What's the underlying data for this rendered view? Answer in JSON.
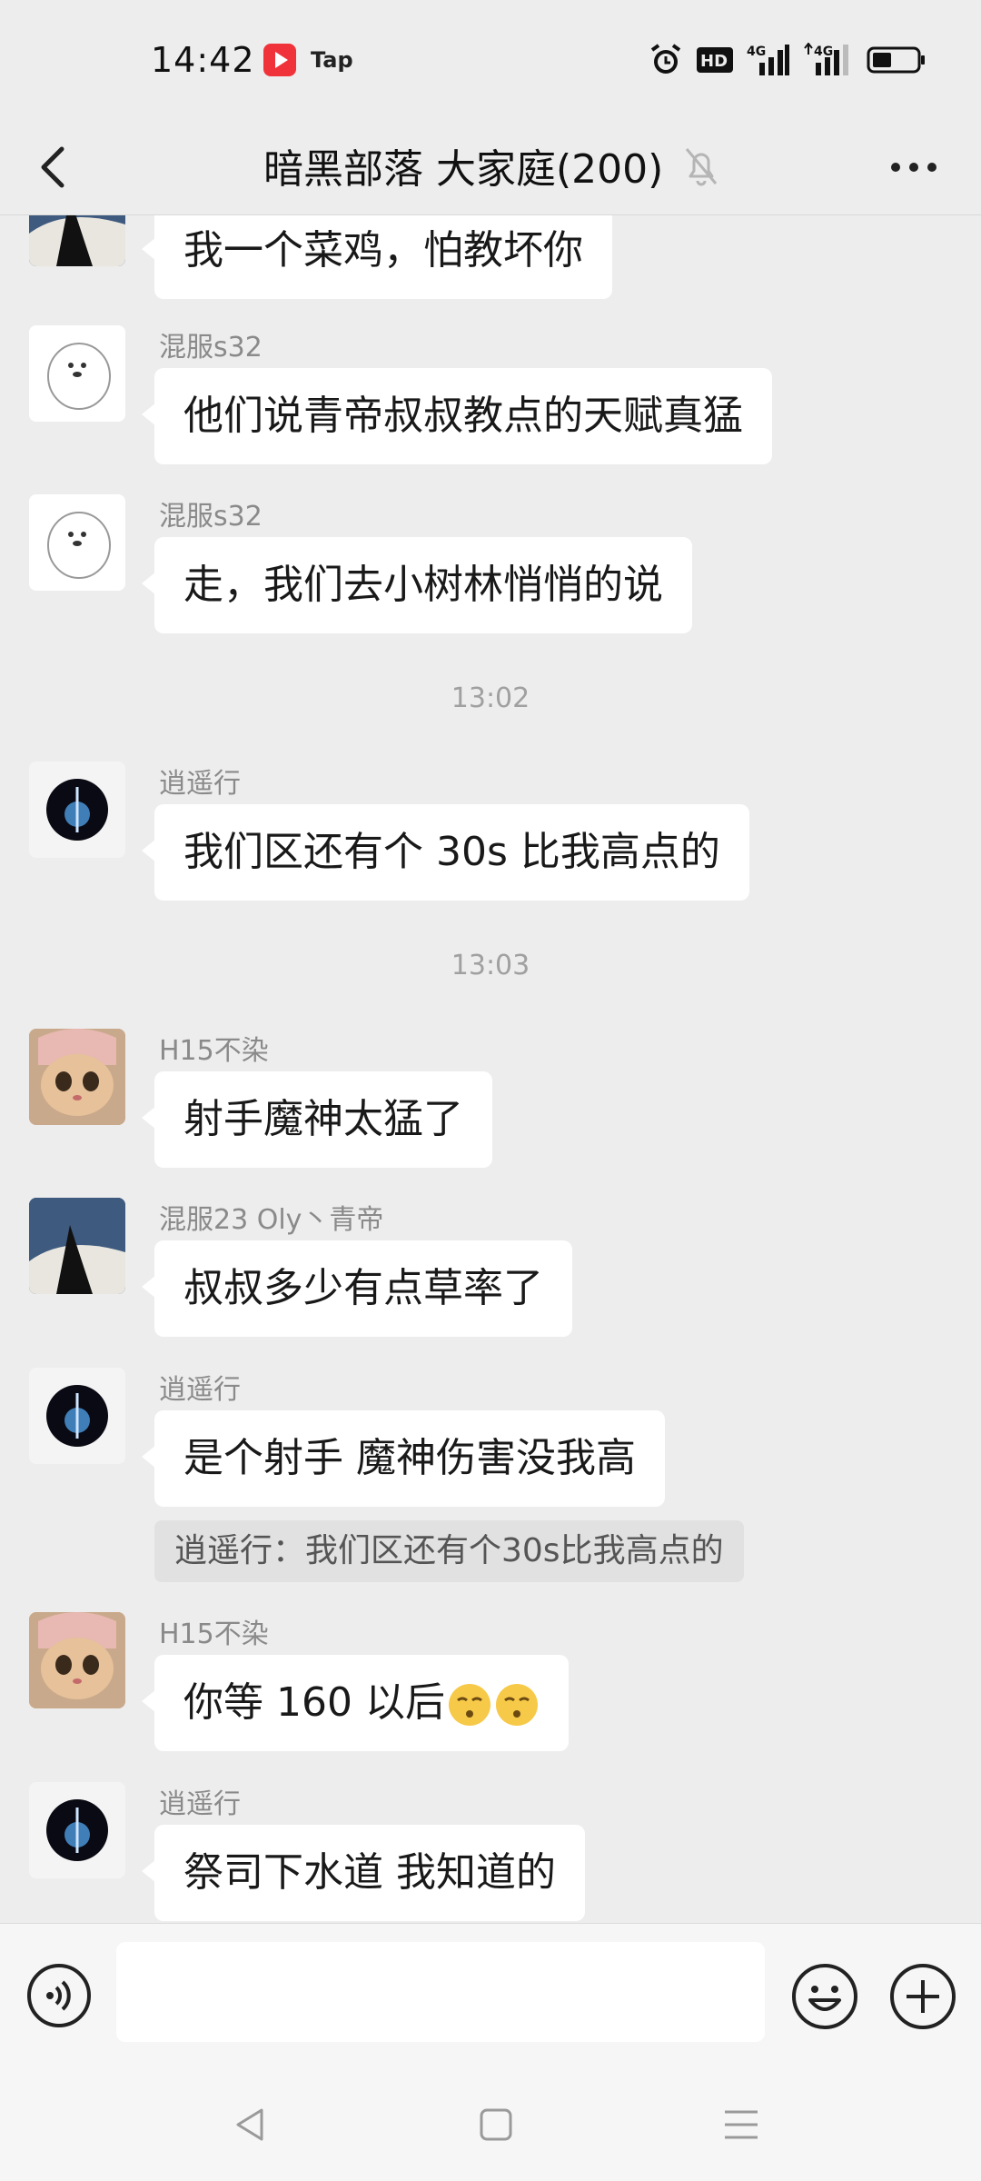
{
  "status": {
    "time": "14:42",
    "app_badge": "Tap",
    "network_hd": "HD",
    "network_a": "4G",
    "network_b": "4G"
  },
  "header": {
    "title": "暗黑部落 大家庭(200)"
  },
  "messages": [
    {
      "text": "我一个菜鸡，怕教坏你"
    },
    {
      "nickname": "混服s32",
      "text": "他们说青帝叔叔教点的天赋真猛"
    },
    {
      "nickname": "混服s32",
      "text": "走，我们去小树林悄悄的说"
    },
    {
      "timestamp": "13:02"
    },
    {
      "nickname": "逍遥行",
      "text": "我们区还有个 30s 比我高点的"
    },
    {
      "timestamp": "13:03"
    },
    {
      "nickname": "H15不染",
      "text": "射手魔神太猛了"
    },
    {
      "nickname": "混服23  Oly丶青帝",
      "text": "叔叔多少有点草率了"
    },
    {
      "nickname": "逍遥行",
      "text": "是个射手 魔神伤害没我高",
      "quote": "逍遥行：我们区还有个30s比我高点的"
    },
    {
      "nickname": "H15不染",
      "text": "你等 160 以后"
    },
    {
      "nickname": "逍遥行",
      "text": "祭司下水道 我知道的"
    }
  ],
  "input": {
    "value": "",
    "placeholder": ""
  },
  "colors": {
    "background": "#ededed",
    "bubble": "#ffffff",
    "meta_text": "#8a8a8a",
    "quote_bg": "#e1e1e1"
  }
}
